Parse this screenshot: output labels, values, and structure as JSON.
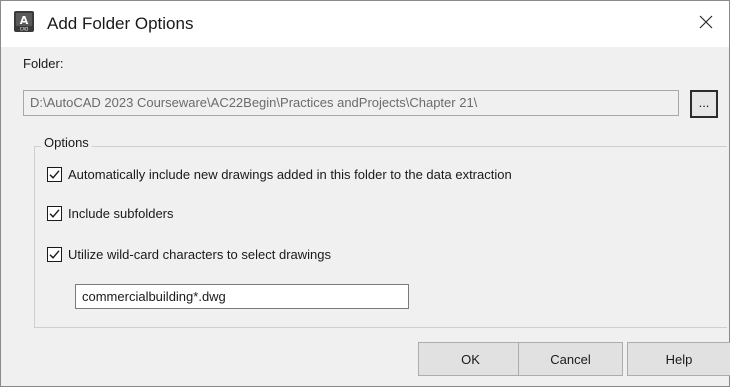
{
  "window": {
    "title": "Add Folder Options",
    "icon": "autocad-app-icon",
    "close_glyph": "✕"
  },
  "folder": {
    "label": "Folder:",
    "path": "D:\\AutoCAD 2023 Courseware\\AC22Begin\\Practices andProjects\\Chapter 21\\",
    "browse_label": "..."
  },
  "options": {
    "group_label": "Options",
    "checkboxes": [
      {
        "label": "Automatically include new drawings added in this folder to the data extraction",
        "checked": true
      },
      {
        "label": "Include subfolders",
        "checked": true
      },
      {
        "label": "Utilize wild-card characters to select drawings",
        "checked": true
      }
    ],
    "wildcard_value": "commercialbuilding*.dwg"
  },
  "buttons": {
    "ok": "OK",
    "cancel": "Cancel",
    "help": "Help"
  }
}
